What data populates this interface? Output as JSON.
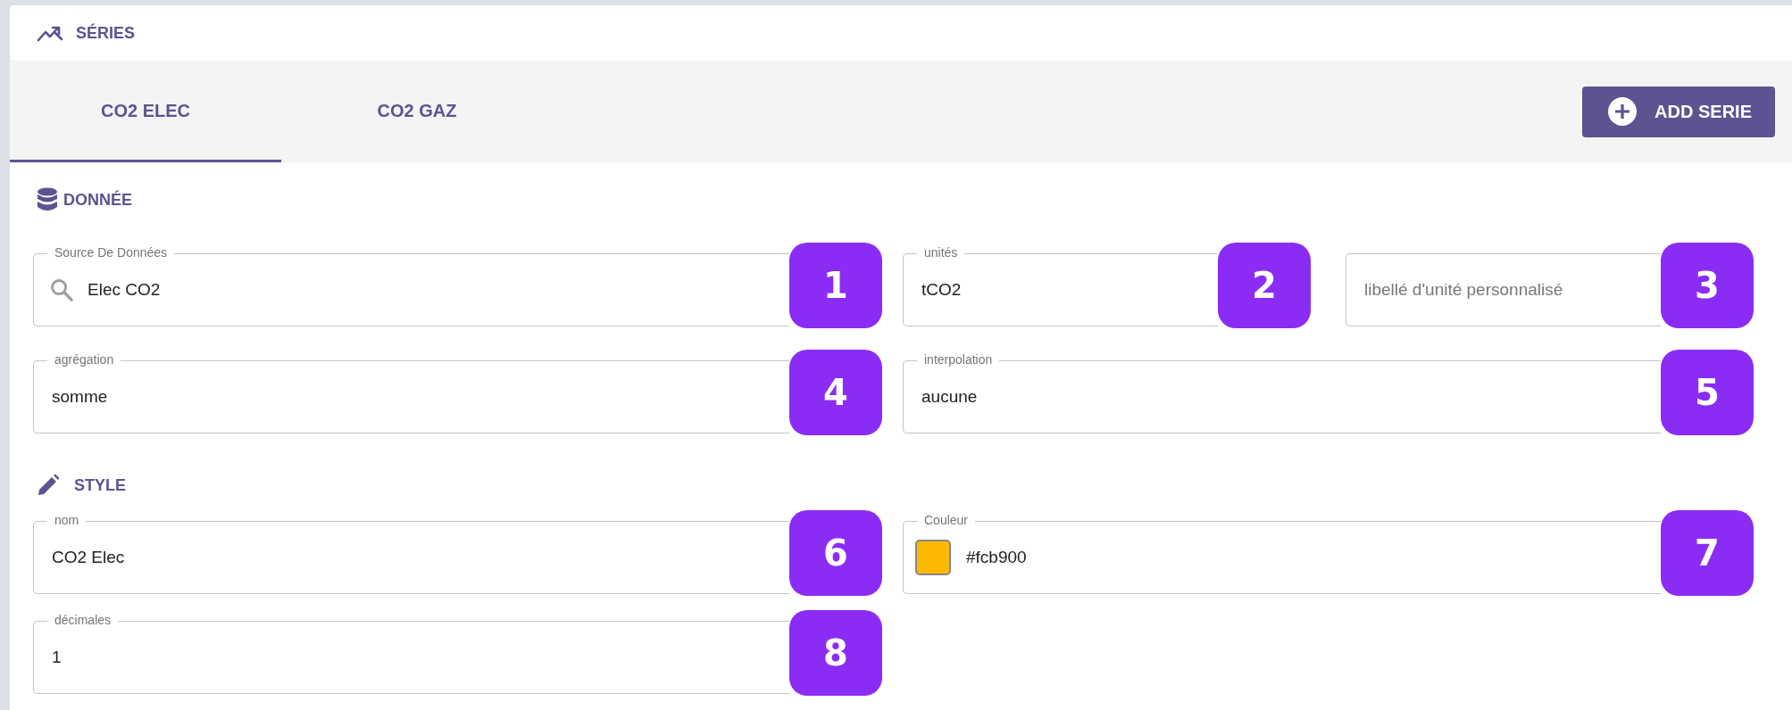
{
  "header": {
    "title": "SÉRIES"
  },
  "tabs": [
    {
      "label": "CO2 ELEC",
      "selected": true
    },
    {
      "label": "CO2 GAZ",
      "selected": false
    }
  ],
  "add_button": {
    "label": "ADD SERIE"
  },
  "sections": [
    {
      "title": "DONNÉE",
      "rows": [
        {
          "left": [
            {
              "kind": "search",
              "label": "Source De Données",
              "value": "Elec CO2",
              "badge": "1"
            }
          ],
          "right": [
            {
              "kind": "text",
              "label": "unités",
              "value": "tCO2",
              "badge": "2"
            },
            {
              "kind": "text",
              "placeholder": "libellé d'unité personnalisé",
              "badge": "3"
            }
          ]
        },
        {
          "left": [
            {
              "kind": "text",
              "label": "agrégation",
              "value": "somme",
              "badge": "4"
            }
          ],
          "right": [
            {
              "kind": "text",
              "label": "interpolation",
              "value": "aucune",
              "badge": "5"
            }
          ]
        }
      ]
    },
    {
      "title": "STYLE",
      "rows": [
        {
          "left": [
            {
              "kind": "text",
              "label": "nom",
              "value": "CO2 Elec",
              "badge": "6"
            }
          ],
          "right": [
            {
              "kind": "color",
              "label": "Couleur",
              "value": "#fcb900",
              "color": "#fcb900",
              "badge": "7"
            }
          ]
        },
        {
          "left": [
            {
              "kind": "text",
              "label": "décimales",
              "value": "1",
              "badge": "8"
            }
          ],
          "right": []
        }
      ]
    }
  ]
}
